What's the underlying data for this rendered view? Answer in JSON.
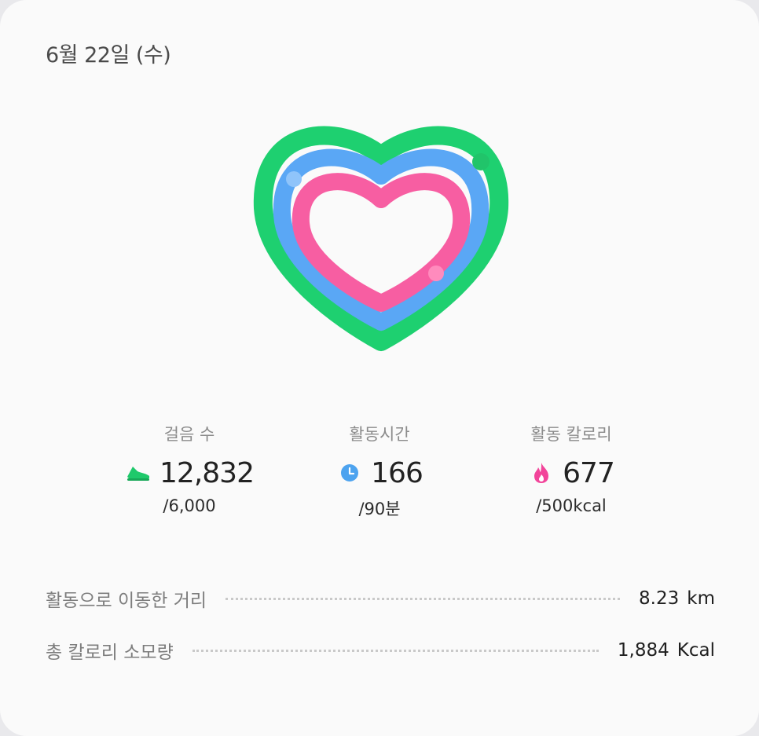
{
  "header": {
    "date": "6월 22일 (수)"
  },
  "activity_rings": {
    "icon": "heart-rings",
    "colors": {
      "steps": "#1ed070",
      "active_time": "#5aa7f5",
      "active_calories": "#f75ea2"
    }
  },
  "stats": [
    {
      "label": "걸음 수",
      "icon": "shoe-icon",
      "value": "12,832",
      "goal": "/6,000",
      "color": "#1fc96b"
    },
    {
      "label": "활동시간",
      "icon": "clock-icon",
      "value": "166",
      "goal": "/90분",
      "color": "#4da3ef"
    },
    {
      "label": "활동 칼로리",
      "icon": "flame-icon",
      "value": "677",
      "goal": "/500kcal",
      "color": "#f2449a"
    }
  ],
  "summary": [
    {
      "label": "활동으로 이동한 거리",
      "value": "8.23",
      "unit": "km"
    },
    {
      "label": "총 칼로리 소모량",
      "value": "1,884",
      "unit": "Kcal"
    }
  ]
}
